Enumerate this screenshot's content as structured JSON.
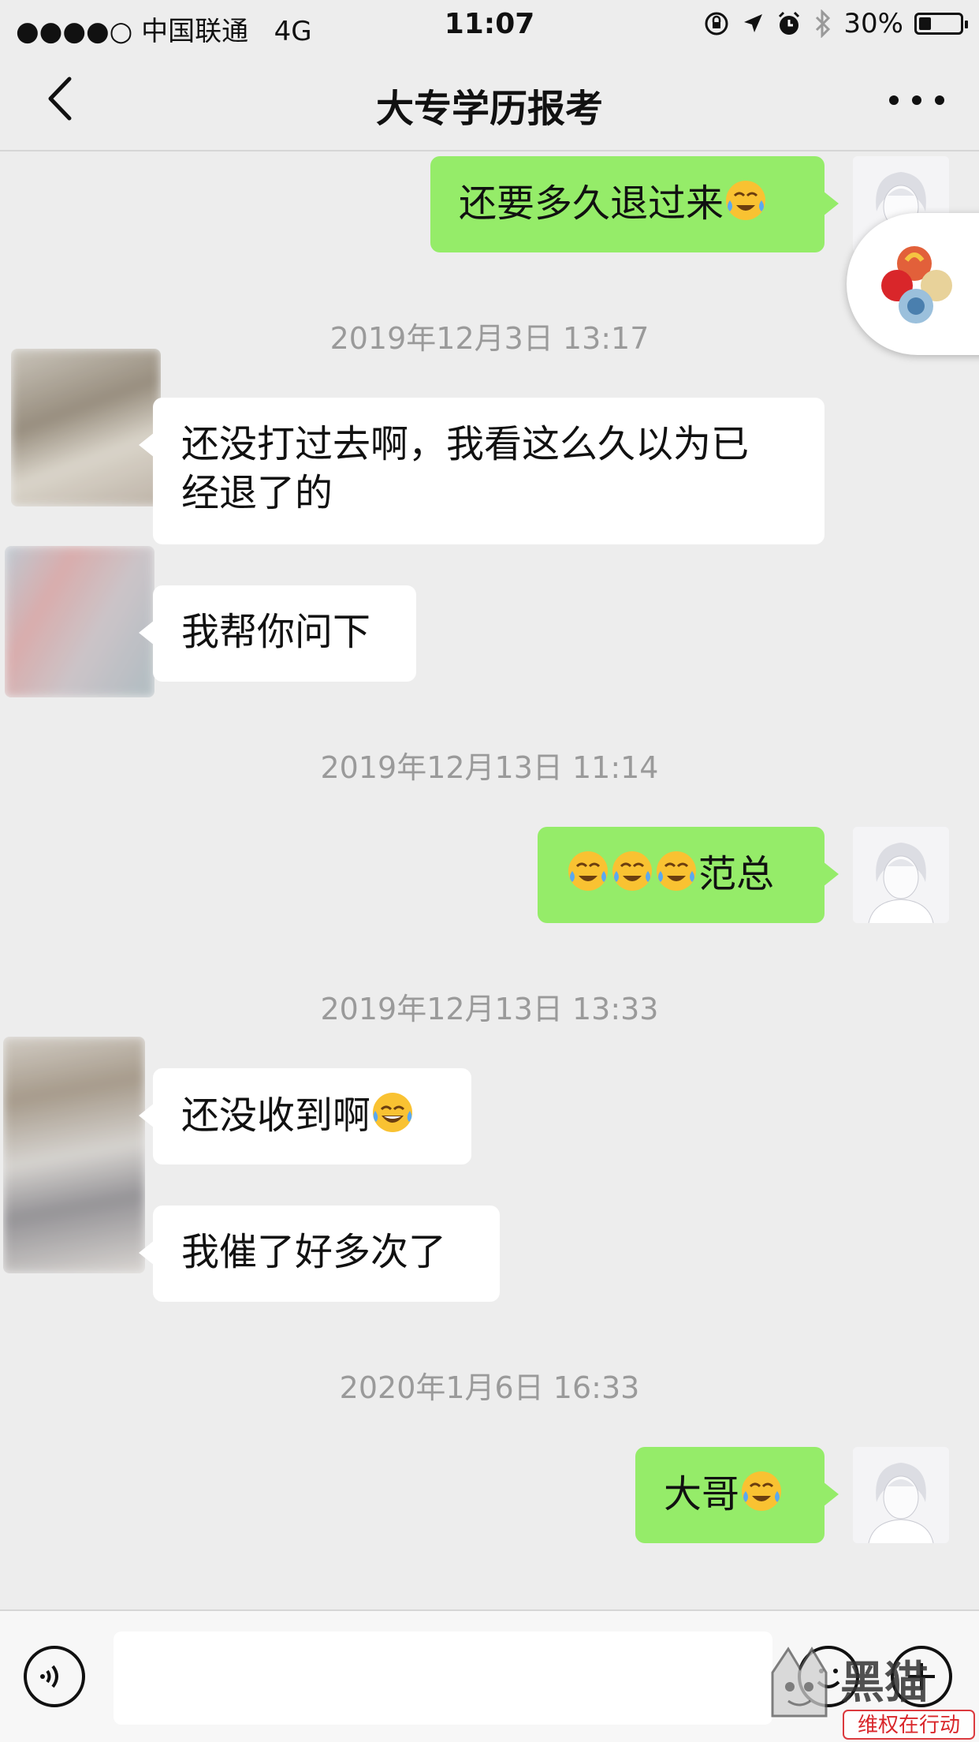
{
  "status_bar": {
    "signal": "●●●●○",
    "carrier": "中国联通",
    "network": "4G",
    "time": "11:07",
    "battery_percent": "30%",
    "battery_level": 0.3
  },
  "navbar": {
    "title": "大专学历报考"
  },
  "messages": [
    {
      "from": "me",
      "text": "还要多久退过来",
      "emojis": [
        "laughing-crying-emoji"
      ]
    },
    {
      "timestamp": "2019年12月3日 13:17"
    },
    {
      "from": "them",
      "text_line1": "还没打过去啊，我看这么久以为已",
      "text_line2": "经退了的"
    },
    {
      "from": "them",
      "text": "我帮你问下"
    },
    {
      "timestamp": "2019年12月13日 11:14"
    },
    {
      "from": "me",
      "text": "范总",
      "emojis": [
        "laughing-crying-emoji",
        "laughing-crying-emoji",
        "laughing-crying-emoji"
      ]
    },
    {
      "timestamp": "2019年12月13日 13:33"
    },
    {
      "from": "them",
      "text": "还没收到啊",
      "emojis": [
        "tears-of-joy-emoji"
      ]
    },
    {
      "from": "them",
      "text": "我催了好多次了"
    },
    {
      "timestamp": "2020年1月6日 16:33"
    },
    {
      "from": "me",
      "text": "大哥",
      "emojis": [
        "laughing-crying-emoji"
      ]
    }
  ],
  "input_bar": {
    "placeholder": ""
  },
  "watermark": {
    "logo_text": "黑猫",
    "sub_text": "维权在行动"
  },
  "colors": {
    "background": "#ededed",
    "my_bubble": "#95ec69",
    "their_bubble": "#ffffff",
    "timestamp": "#9a9a9a",
    "watermark_red": "#d9262a"
  }
}
